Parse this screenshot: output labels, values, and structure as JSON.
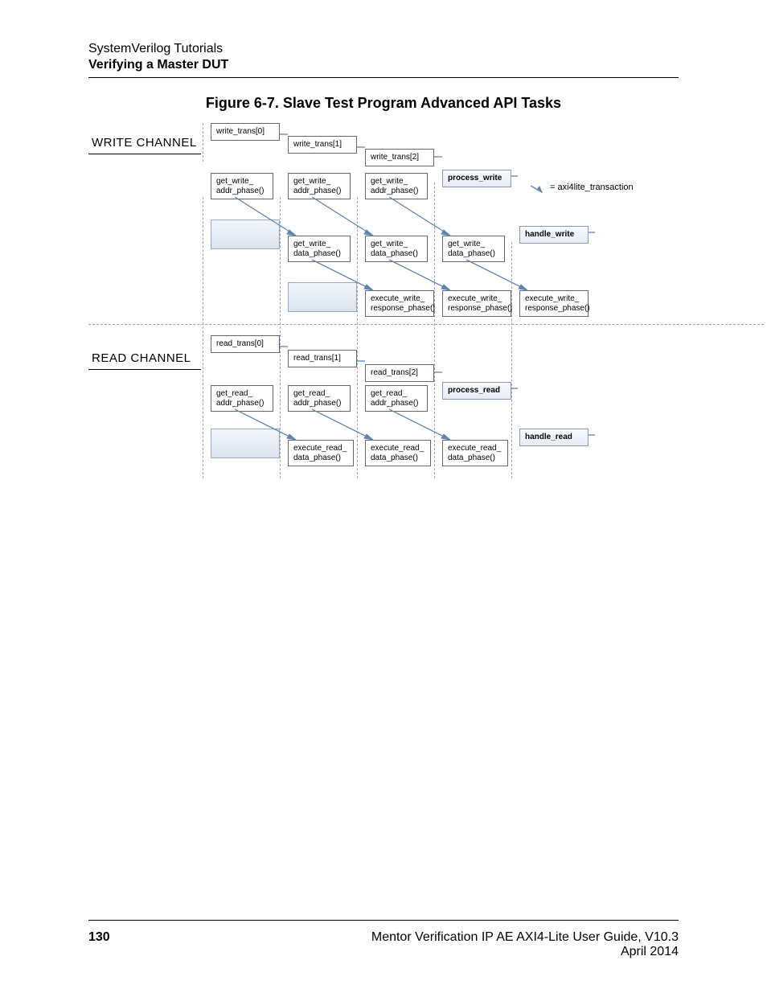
{
  "header": {
    "line1": "SystemVerilog Tutorials",
    "line2": "Verifying a Master DUT"
  },
  "figure": {
    "title": "Figure 6-7. Slave Test Program Advanced API Tasks"
  },
  "diagram": {
    "write_channel_label": "WRITE CHANNEL",
    "read_channel_label": "READ CHANNEL",
    "legend": "= axi4lite_transaction",
    "write": {
      "trans": [
        "write_trans[0]",
        "write_trans[1]",
        "write_trans[2]"
      ],
      "addr": [
        "get_write_\naddr_phase()",
        "get_write_\naddr_phase()",
        "get_write_\naddr_phase()"
      ],
      "data": [
        "get_write_\ndata_phase()",
        "get_write_\ndata_phase()",
        "get_write_\ndata_phase()"
      ],
      "resp": [
        "execute_write_\nresponse_phase()",
        "execute_write_\nresponse_phase()",
        "execute_write_\nresponse_phase()"
      ],
      "process": "process_write",
      "handle": "handle_write"
    },
    "read": {
      "trans": [
        "read_trans[0]",
        "read_trans[1]",
        "read_trans[2]"
      ],
      "addr": [
        "get_read_\naddr_phase()",
        "get_read_\naddr_phase()",
        "get_read_\naddr_phase()"
      ],
      "data": [
        "execute_read_\ndata_phase()",
        "execute_read_\ndata_phase()",
        "execute_read_\ndata_phase()"
      ],
      "process": "process_read",
      "handle": "handle_read"
    }
  },
  "footer": {
    "page": "130",
    "title": "Mentor Verification IP AE AXI4-Lite User Guide, V10.3",
    "date": "April 2014"
  }
}
